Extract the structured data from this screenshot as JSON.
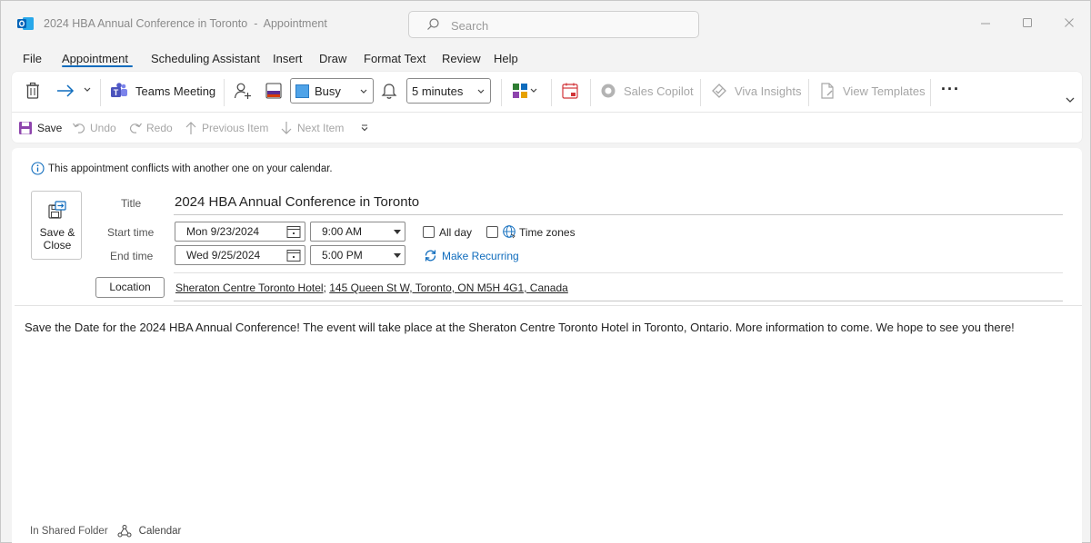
{
  "window": {
    "title": "2024 HBA Annual Conference in Toronto",
    "title_separator": "-",
    "subtitle": "Appointment",
    "search_placeholder": "Search"
  },
  "menu": [
    "File",
    "Appointment",
    "Scheduling Assistant",
    "Insert",
    "Draw",
    "Format Text",
    "Review",
    "Help"
  ],
  "menu_active": "Appointment",
  "ribbon": {
    "teams_meeting": "Teams Meeting",
    "show_as": "Busy",
    "reminder": "5 minutes",
    "sales_copilot": "Sales Copilot",
    "viva_insights": "Viva Insights",
    "view_templates": "View Templates",
    "more": "···"
  },
  "quick_access": {
    "save": "Save",
    "undo": "Undo",
    "redo": "Redo",
    "previous_item": "Previous Item",
    "next_item": "Next Item"
  },
  "form": {
    "info_message": "This appointment conflicts with another one on your calendar.",
    "save_close_line1": "Save &",
    "save_close_line2": "Close",
    "title_label": "Title",
    "title_value": "2024 HBA Annual Conference in Toronto",
    "start_label": "Start time",
    "start_date": "Mon 9/23/2024",
    "start_time": "9:00 AM",
    "end_label": "End time",
    "end_date": "Wed 9/25/2024",
    "end_time": "5:00 PM",
    "all_day": "All day",
    "time_zones": "Time zones",
    "make_recurring": "Make Recurring",
    "location_button": "Location",
    "location_name": "Sheraton Centre Toronto Hotel",
    "location_separator": ";",
    "location_address": "145 Queen St W, Toronto, ON M5H 4G1, Canada"
  },
  "body_text": "Save the Date for the 2024 HBA Annual Conference! The event will take place at the Sheraton Centre Toronto Hotel in Toronto, Ontario. More information to come. We hope to see you there!",
  "footer": {
    "folder_label": "In Shared Folder",
    "folder_name": "Calendar"
  },
  "colors": {
    "accent": "#0f6cbd",
    "outlook_blue": "#0364b8",
    "busy_swatch": "#4fa3e8"
  }
}
